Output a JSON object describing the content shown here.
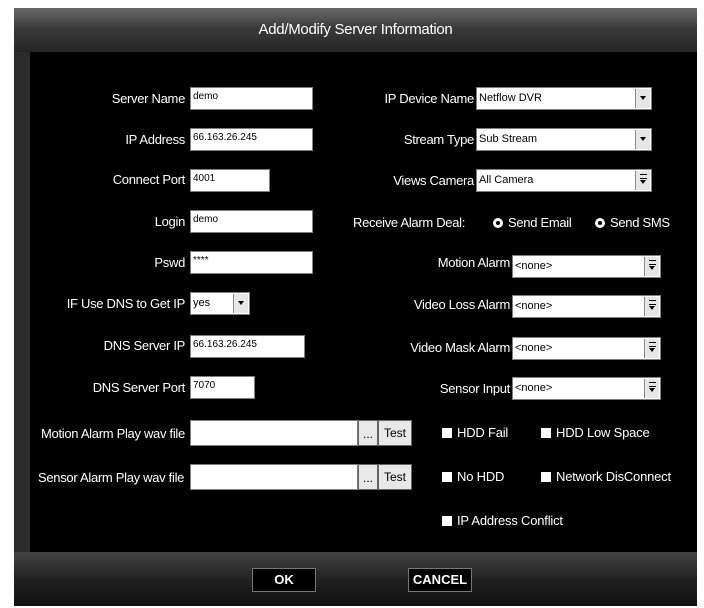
{
  "dialog": {
    "title": "Add/Modify Server Information"
  },
  "left": {
    "server_name": {
      "label": "Server Name",
      "value": "demo"
    },
    "ip_address": {
      "label": "IP Address",
      "value": "66.163.26.245"
    },
    "connect_port": {
      "label": "Connect Port",
      "value": "4001"
    },
    "login": {
      "label": "Login",
      "value": "demo"
    },
    "pswd": {
      "label": "Pswd",
      "value": "****"
    },
    "dns_use": {
      "label": "IF Use DNS to Get IP",
      "value": "yes"
    },
    "dns_server_ip": {
      "label": "DNS Server IP",
      "value": "66.163.26.245"
    },
    "dns_server_port": {
      "label": "DNS Server Port",
      "value": "7070"
    },
    "motion_wav": {
      "label": "Motion Alarm Play wav file",
      "value": "",
      "browse": "...",
      "test": "Test"
    },
    "sensor_wav": {
      "label": "Sensor Alarm Play wav file",
      "value": "",
      "browse": "...",
      "test": "Test"
    }
  },
  "right": {
    "ip_device_name": {
      "label": "IP Device Name",
      "value": "Netflow DVR"
    },
    "stream_type": {
      "label": "Stream Type",
      "value": "Sub Stream"
    },
    "views_camera": {
      "label": "Views Camera",
      "value": "All Camera"
    },
    "receive_alarm": {
      "label": "Receive Alarm  Deal:",
      "option1": "Send Email",
      "option2": "Send SMS"
    },
    "motion_alarm": {
      "label": "Motion Alarm",
      "value": "<none>"
    },
    "video_loss_alarm": {
      "label": "Video Loss Alarm",
      "value": "<none>"
    },
    "video_mask_alarm": {
      "label": "Video Mask Alarm",
      "value": "<none>"
    },
    "sensor_input": {
      "label": "Sensor Input",
      "value": "<none>"
    },
    "checks": {
      "hdd_fail": "HDD Fail",
      "hdd_low_space": "HDD Low Space",
      "no_hdd": "No HDD",
      "network_disconnect": "Network DisConnect",
      "ip_conflict": "IP Address Conflict"
    }
  },
  "footer": {
    "ok": "OK",
    "cancel": "CANCEL"
  }
}
